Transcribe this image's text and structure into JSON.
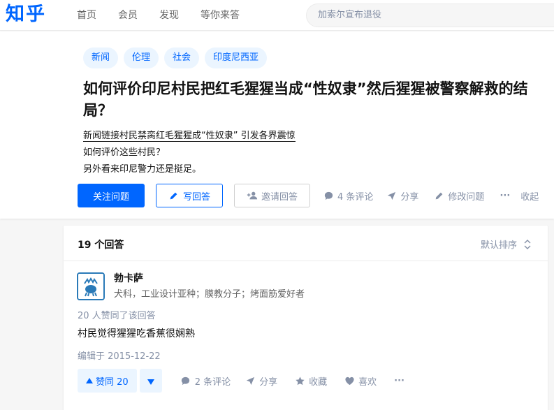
{
  "header": {
    "logo": "知乎",
    "nav": [
      "首页",
      "会员",
      "发现",
      "等你来答"
    ],
    "search_placeholder": "加索尔宣布退役"
  },
  "question": {
    "topics": [
      "新闻",
      "伦理",
      "社会",
      "印度尼西亚"
    ],
    "title": "如何评价印尼村民把红毛猩猩当成“性奴隶”然后猩猩被警察解救的结局？",
    "detail_link": "新闻链接村民禁脔红毛猩猩成“性奴隶” 引发各界震惊",
    "detail_line2": "如何评价这些村民？",
    "detail_line3": "另外看来印尼警力还是挺足。",
    "actions": {
      "follow": "关注问题",
      "write": "写回答",
      "invite": "邀请回答",
      "comments": "4 条评论",
      "share": "分享",
      "edit": "修改问题",
      "more": "···",
      "collapse": "收起"
    }
  },
  "answers": {
    "count_label": "19 个回答",
    "sort_label": "默认排序",
    "items": [
      {
        "author": "勃卡萨",
        "bio": "犬科，工业设计亚种；膜教分子；烤面筋爱好者",
        "voters": "20 人赞同了该回答",
        "content": "村民觉得猩猩吃香蕉很娴熟",
        "edited": "编辑于 2015-12-22",
        "vote_label": "赞同 20",
        "comments": "2 条评论",
        "share": "分享",
        "collect": "收藏",
        "like": "喜欢",
        "more": "···"
      }
    ]
  },
  "colors": {
    "brand": "#0066ff",
    "brand_light": "#ebf5ff",
    "muted": "#8590a6"
  }
}
